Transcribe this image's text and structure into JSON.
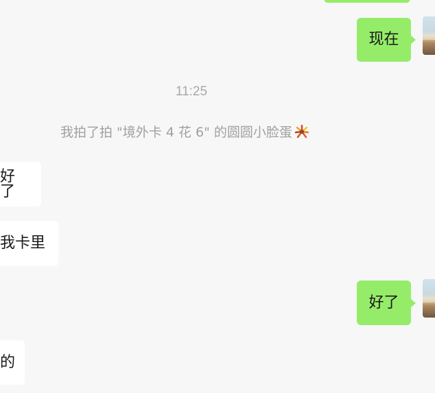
{
  "messages": {
    "now": "现在",
    "ok_me": "好了",
    "ok_other": "好了",
    "in_my_card": "我卡里",
    "possessive": "的"
  },
  "time": "11:25",
  "system_message": {
    "text": "我拍了拍 \"境外卡 4 花 6\" 的圆圆小脸蛋",
    "emoji_icon": "firework-icon"
  },
  "colors": {
    "my_bubble": "#95ec69",
    "other_bubble": "#ffffff",
    "background": "#f7f7f7",
    "meta_text": "#a8a8a8"
  }
}
